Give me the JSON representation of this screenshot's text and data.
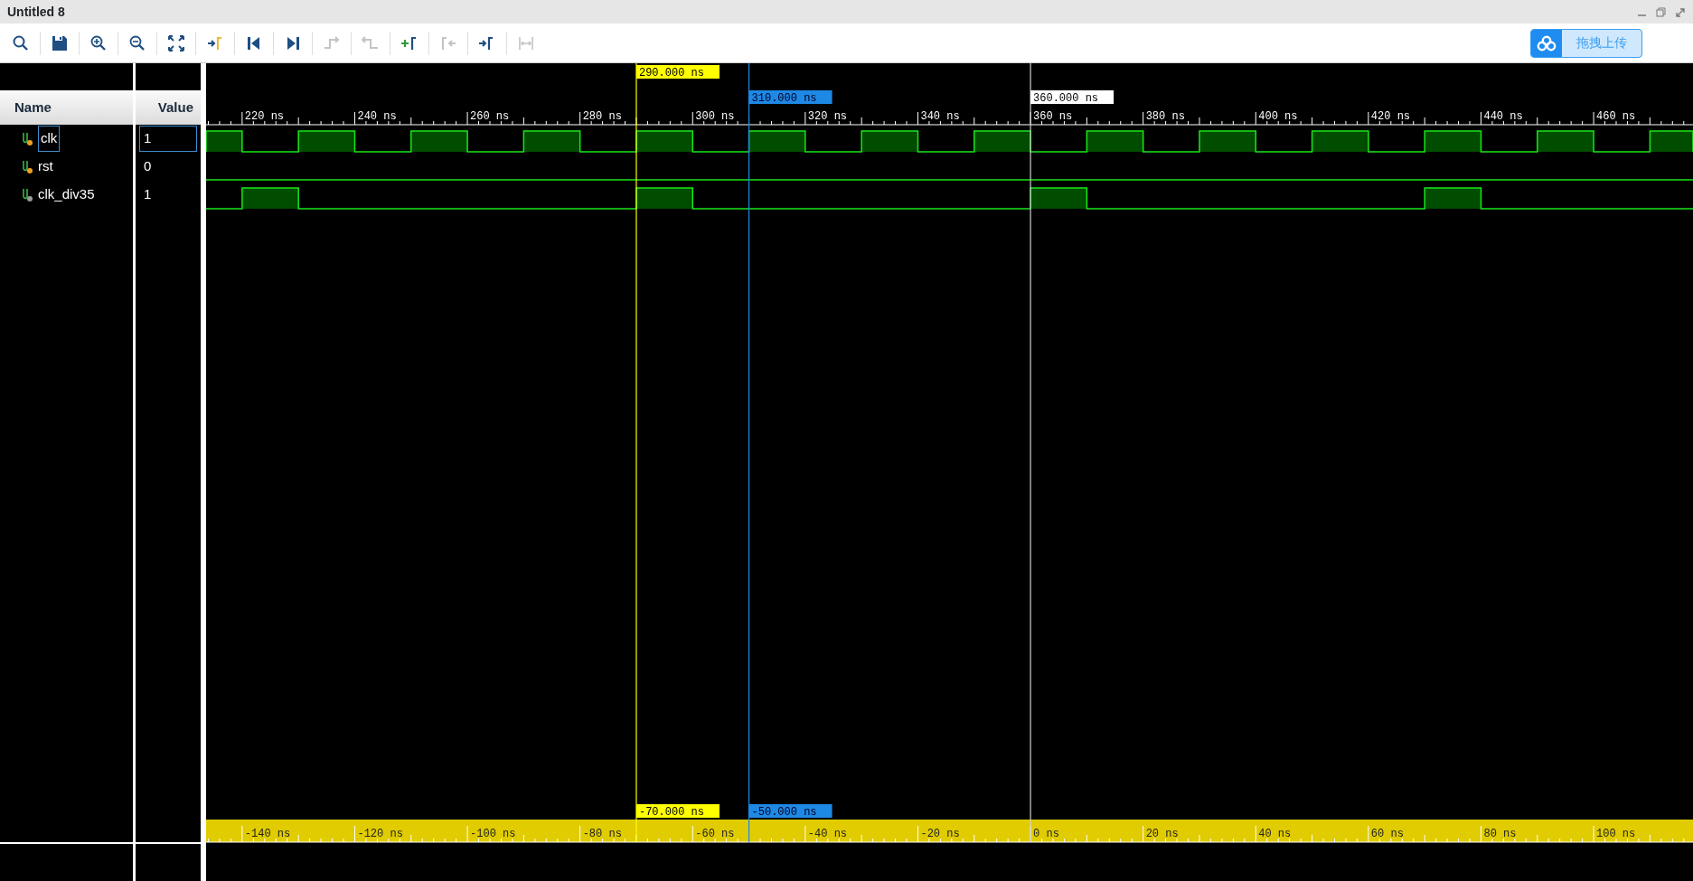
{
  "window": {
    "title": "Untitled 8"
  },
  "toolbar": [
    {
      "kind": "search",
      "disabled": false
    },
    {
      "kind": "save",
      "disabled": false
    },
    {
      "kind": "zoom_in",
      "disabled": false
    },
    {
      "kind": "zoom_out",
      "disabled": false
    },
    {
      "kind": "fit",
      "disabled": false
    },
    {
      "kind": "goto_cursor",
      "disabled": false
    },
    {
      "kind": "first",
      "disabled": false
    },
    {
      "kind": "last",
      "disabled": false
    },
    {
      "kind": "prev_transition",
      "disabled": true
    },
    {
      "kind": "next_transition",
      "disabled": true
    },
    {
      "kind": "add_marker",
      "disabled": false
    },
    {
      "kind": "prev_marker",
      "disabled": true
    },
    {
      "kind": "next_marker",
      "disabled": false
    },
    {
      "kind": "swap",
      "disabled": true
    }
  ],
  "upload_button": {
    "label": "拖拽上传"
  },
  "columns": [
    "Name",
    "Value"
  ],
  "signals": [
    {
      "name": "clk",
      "value": "1",
      "kind": "input",
      "selected": true
    },
    {
      "name": "rst",
      "value": "0",
      "kind": "input",
      "selected": false
    },
    {
      "name": "clk_div35",
      "value": "1",
      "kind": "output",
      "selected": false
    }
  ],
  "ruler": {
    "labels": [
      "220 ns",
      "240 ns",
      "260 ns",
      "280 ns",
      "300 ns",
      "320 ns",
      "340 ns",
      "360 ns",
      "380 ns",
      "400 ns",
      "420 ns",
      "440 ns",
      "460 ns"
    ]
  },
  "markers": [
    {
      "label": "290.000 ns",
      "kind": "cursor"
    },
    {
      "label": "310.000 ns",
      "kind": "marker"
    },
    {
      "label": "360.000 ns",
      "kind": "origin"
    }
  ],
  "delta_markers": [
    {
      "label": "-70.000 ns",
      "kind": "cursor"
    },
    {
      "label": "-50.000 ns",
      "kind": "marker"
    }
  ],
  "delta_ruler": {
    "labels": [
      "-140 ns",
      "-120 ns",
      "-100 ns",
      "-80 ns",
      "-60 ns",
      "-40 ns",
      "-20 ns",
      "0 ns",
      "20 ns",
      "40 ns",
      "60 ns",
      "80 ns",
      "100 ns"
    ]
  }
}
